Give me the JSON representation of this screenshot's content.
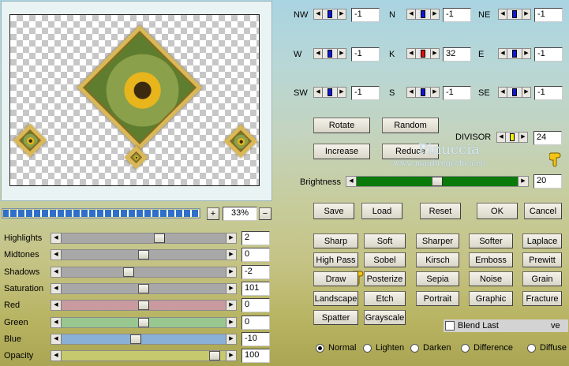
{
  "preview": {
    "zoom": "33%",
    "plus": "+",
    "minus": "−"
  },
  "matrix": [
    {
      "label": "NW",
      "value": "-1"
    },
    {
      "label": "N",
      "value": "-1"
    },
    {
      "label": "NE",
      "value": "-1"
    },
    {
      "label": "W",
      "value": "-1"
    },
    {
      "label": "K",
      "value": "32"
    },
    {
      "label": "E",
      "value": "-1"
    },
    {
      "label": "SW",
      "value": "-1"
    },
    {
      "label": "S",
      "value": "-1"
    },
    {
      "label": "SE",
      "value": "-1"
    }
  ],
  "buttons": {
    "rotate": "Rotate",
    "random": "Random",
    "increase": "Increase",
    "reduce": "Reduce",
    "save": "Save",
    "load": "Load",
    "reset": "Reset",
    "ok": "OK",
    "cancel": "Cancel"
  },
  "divisor": {
    "label": "DIVISOR",
    "value": "24"
  },
  "brightness": {
    "label": "Brightness",
    "value": "20"
  },
  "sliders": [
    {
      "label": "Highlights",
      "value": "2"
    },
    {
      "label": "Midtones",
      "value": "0"
    },
    {
      "label": "Shadows",
      "value": "-2"
    },
    {
      "label": "Saturation",
      "value": "101"
    },
    {
      "label": "Red",
      "value": "0"
    },
    {
      "label": "Green",
      "value": "0"
    },
    {
      "label": "Blue",
      "value": "-10"
    },
    {
      "label": "Opacity",
      "value": "100"
    }
  ],
  "presets": [
    "Sharp",
    "Soft",
    "Sharper",
    "Softer",
    "Laplace",
    "High Pass",
    "Sobel",
    "Kirsch",
    "Emboss",
    "Prewitt",
    "Draw",
    "Posterize",
    "Sepia",
    "Noise",
    "Grain",
    "Landscape",
    "Etch",
    "Portrait",
    "Graphic",
    "Fracture",
    "Spatter",
    "Grayscale"
  ],
  "blend_last": {
    "label": "Blend Last",
    "suffix": "ve"
  },
  "modes": [
    {
      "label": "Normal",
      "on": true
    },
    {
      "label": "Lighten"
    },
    {
      "label": "Darken"
    },
    {
      "label": "Difference"
    },
    {
      "label": "Diffuse"
    }
  ],
  "watermark": {
    "line1": "Pinuccia",
    "line2": "www.maidiregrafica.eu"
  },
  "colors": {
    "matrix_knob": "#0c17d8",
    "center_knob": "#e01010",
    "brightness_track": "#0a7a0a",
    "divisor_knob": "#f5f000"
  }
}
